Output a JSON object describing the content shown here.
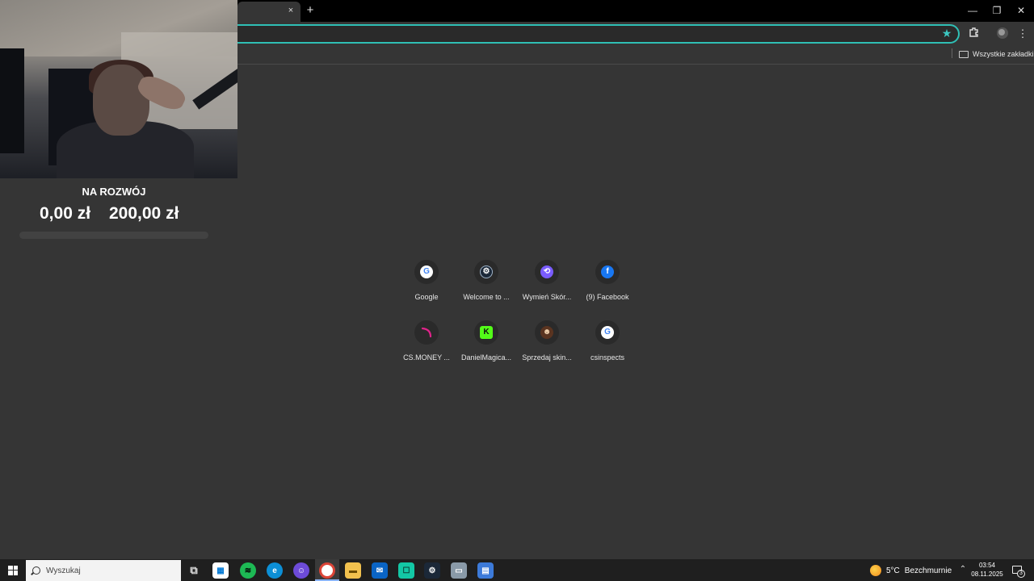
{
  "browser": {
    "tab_close": "×",
    "new_tab": "+",
    "window_controls": {
      "minimize": "—",
      "restore": "❐",
      "close": "✕"
    },
    "bookmarks_all": "Wszystkie zakładki"
  },
  "goal": {
    "title": "NA ROZWÓJ",
    "current": "0,00 zł",
    "target": "200,00 zł",
    "progress_fraction": 0.0,
    "bar_color": "#6fd36f"
  },
  "shortcuts": [
    {
      "label": "Google",
      "icon": "google-icon"
    },
    {
      "label": "Welcome to ...",
      "icon": "steam-icon"
    },
    {
      "label": "Wymień Skór...",
      "icon": "exchange-icon"
    },
    {
      "label": "(9) Facebook",
      "icon": "facebook-icon"
    },
    {
      "label": "CS.MONEY ...",
      "icon": "csmoney-icon"
    },
    {
      "label": "DanielMagica...",
      "icon": "kick-icon"
    },
    {
      "label": "Sprzedaj skin...",
      "icon": "skin-icon"
    },
    {
      "label": "csinspects",
      "icon": "google-icon"
    }
  ],
  "taskbar": {
    "search_placeholder": "Wyszukaj",
    "weather": {
      "temp": "5°C",
      "condition": "Bezchmurnie"
    },
    "clock": {
      "time": "03:54",
      "date": "08.11.2025"
    },
    "notifications_count": "3"
  },
  "colors": {
    "accent": "#2fbfb5",
    "page_bg": "#353535",
    "taskbar_bg": "#1f1f1f"
  }
}
